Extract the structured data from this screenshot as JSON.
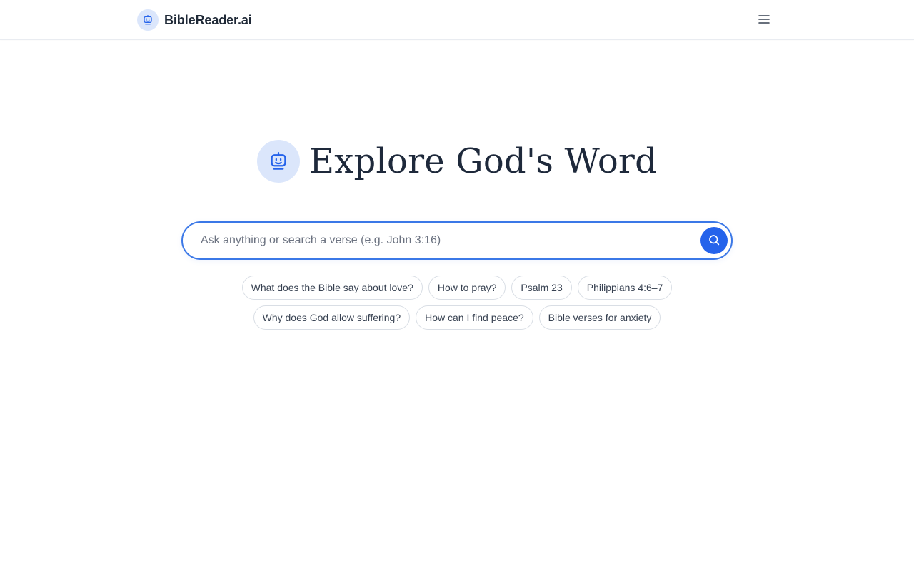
{
  "header": {
    "brand_name": "BibleReader.ai",
    "logo_icon": "robot-face-icon",
    "menu_icon": "hamburger-menu-icon"
  },
  "hero": {
    "title": "Explore God's Word",
    "icon": "robot-face-icon"
  },
  "search": {
    "value": "",
    "placeholder": "Ask anything or search a verse (e.g. John 3:16)",
    "button_icon": "search-icon"
  },
  "suggestions": {
    "row1": [
      "What does the Bible say about love?",
      "How to pray?",
      "Psalm 23",
      "Philippians 4:6–7"
    ],
    "row2": [
      "Why does God allow suffering?",
      "How can I find peace?",
      "Bible verses for anxiety"
    ]
  },
  "colors": {
    "accent": "#2563eb",
    "search_border": "#3b78e7",
    "icon_bg": "#dbe6fb",
    "text_dark": "#1e293b"
  }
}
